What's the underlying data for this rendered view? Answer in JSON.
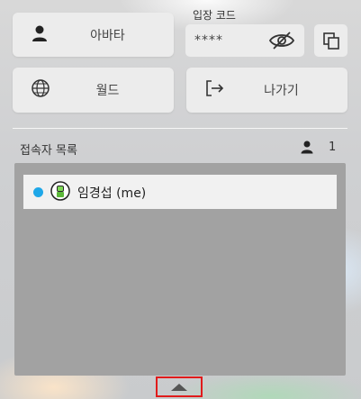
{
  "menu": {
    "avatar_label": "아바타",
    "world_label": "월드",
    "exit_label": "나가기"
  },
  "entry_code": {
    "label": "입장 코드",
    "masked_value": "****"
  },
  "user_list": {
    "title": "접속자 목록",
    "count": "1",
    "users": [
      {
        "name": "임경섭 (me)",
        "status_color": "#1ea7e8"
      }
    ]
  },
  "colors": {
    "status_online": "#1ea7e8",
    "highlight_box": "#e01b1b"
  }
}
